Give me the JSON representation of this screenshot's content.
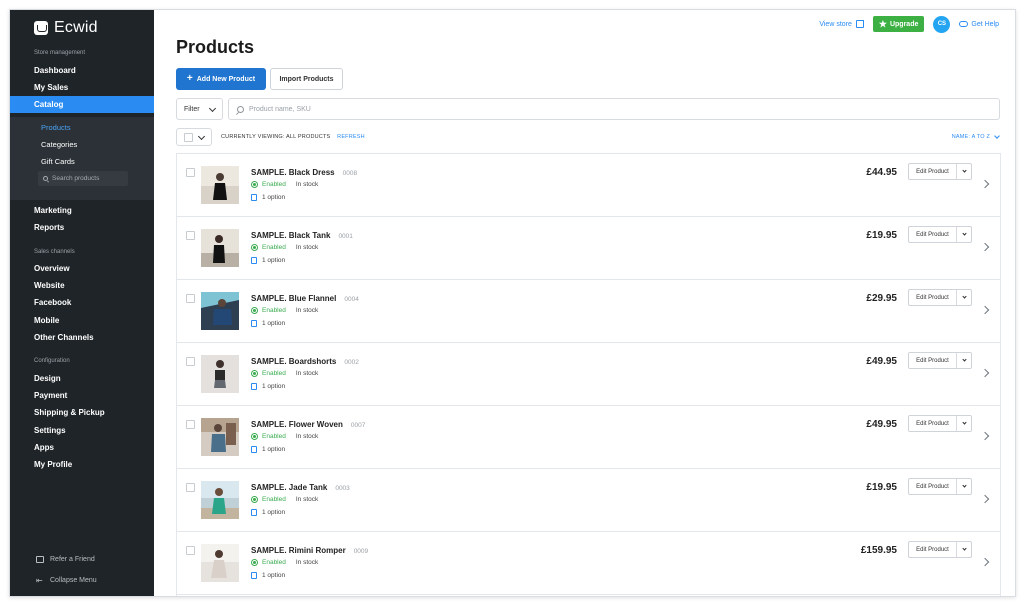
{
  "sidebar": {
    "logo": "Ecwid",
    "store_management_title": "Store management",
    "primary": [
      {
        "label": "Dashboard"
      },
      {
        "label": "My Sales"
      },
      {
        "label": "Catalog"
      }
    ],
    "catalog_items": [
      {
        "label": "Products"
      },
      {
        "label": "Categories"
      },
      {
        "label": "Gift Cards"
      }
    ],
    "search_placeholder": "Search products",
    "secondary": [
      {
        "label": "Marketing"
      },
      {
        "label": "Reports"
      }
    ],
    "sales_channels_title": "Sales channels",
    "sales_channels": [
      {
        "label": "Overview"
      },
      {
        "label": "Website"
      },
      {
        "label": "Facebook"
      },
      {
        "label": "Mobile"
      },
      {
        "label": "Other Channels"
      }
    ],
    "configuration_title": "Configuration",
    "configuration": [
      {
        "label": "Design"
      },
      {
        "label": "Payment"
      },
      {
        "label": "Shipping & Pickup"
      },
      {
        "label": "Settings"
      },
      {
        "label": "Apps"
      },
      {
        "label": "My Profile"
      }
    ],
    "bottom": {
      "refer_label": "Refer a Friend",
      "collapse_label": "Collapse Menu"
    }
  },
  "topbar": {
    "view_store_label": "View store",
    "upgrade_label": "Upgrade",
    "avatar_initials": "CS",
    "help_label": "Get Help"
  },
  "main": {
    "title": "Products",
    "add_button_label": "Add New Product",
    "import_button_label": "Import Products",
    "filter_label": "Filter",
    "search_placeholder": "Product name, SKU",
    "viewing_text": "CURRENTLY VIEWING: ALL PRODUCTS",
    "refresh_label": "REFRESH",
    "sort_label": "NAME: A TO Z"
  },
  "products": [
    {
      "name": "SAMPLE. Black Dress",
      "sku": "0008",
      "status": "Enabled",
      "stock": "In stock",
      "options": "1 option",
      "price": "£44.95",
      "edit_label": "Edit Product"
    },
    {
      "name": "SAMPLE. Black Tank",
      "sku": "0001",
      "status": "Enabled",
      "stock": "In stock",
      "options": "1 option",
      "price": "£19.95",
      "edit_label": "Edit Product"
    },
    {
      "name": "SAMPLE. Blue Flannel",
      "sku": "0004",
      "status": "Enabled",
      "stock": "In stock",
      "options": "1 option",
      "price": "£29.95",
      "edit_label": "Edit Product"
    },
    {
      "name": "SAMPLE. Boardshorts",
      "sku": "0002",
      "status": "Enabled",
      "stock": "In stock",
      "options": "1 option",
      "price": "£49.95",
      "edit_label": "Edit Product"
    },
    {
      "name": "SAMPLE. Flower Woven",
      "sku": "0007",
      "status": "Enabled",
      "stock": "In stock",
      "options": "1 option",
      "price": "£49.95",
      "edit_label": "Edit Product"
    },
    {
      "name": "SAMPLE. Jade Tank",
      "sku": "0003",
      "status": "Enabled",
      "stock": "In stock",
      "options": "1 option",
      "price": "£19.95",
      "edit_label": "Edit Product"
    },
    {
      "name": "SAMPLE. Rimini Romper",
      "sku": "0009",
      "status": "Enabled",
      "stock": "In stock",
      "options": "1 option",
      "price": "£159.95",
      "edit_label": "Edit Product"
    }
  ],
  "colors": {
    "sidebar": "#1f2428",
    "active": "#2a8bf2",
    "primary_button": "#1f75d0",
    "upgrade": "#3cb043",
    "enabled": "#3aab4f"
  }
}
